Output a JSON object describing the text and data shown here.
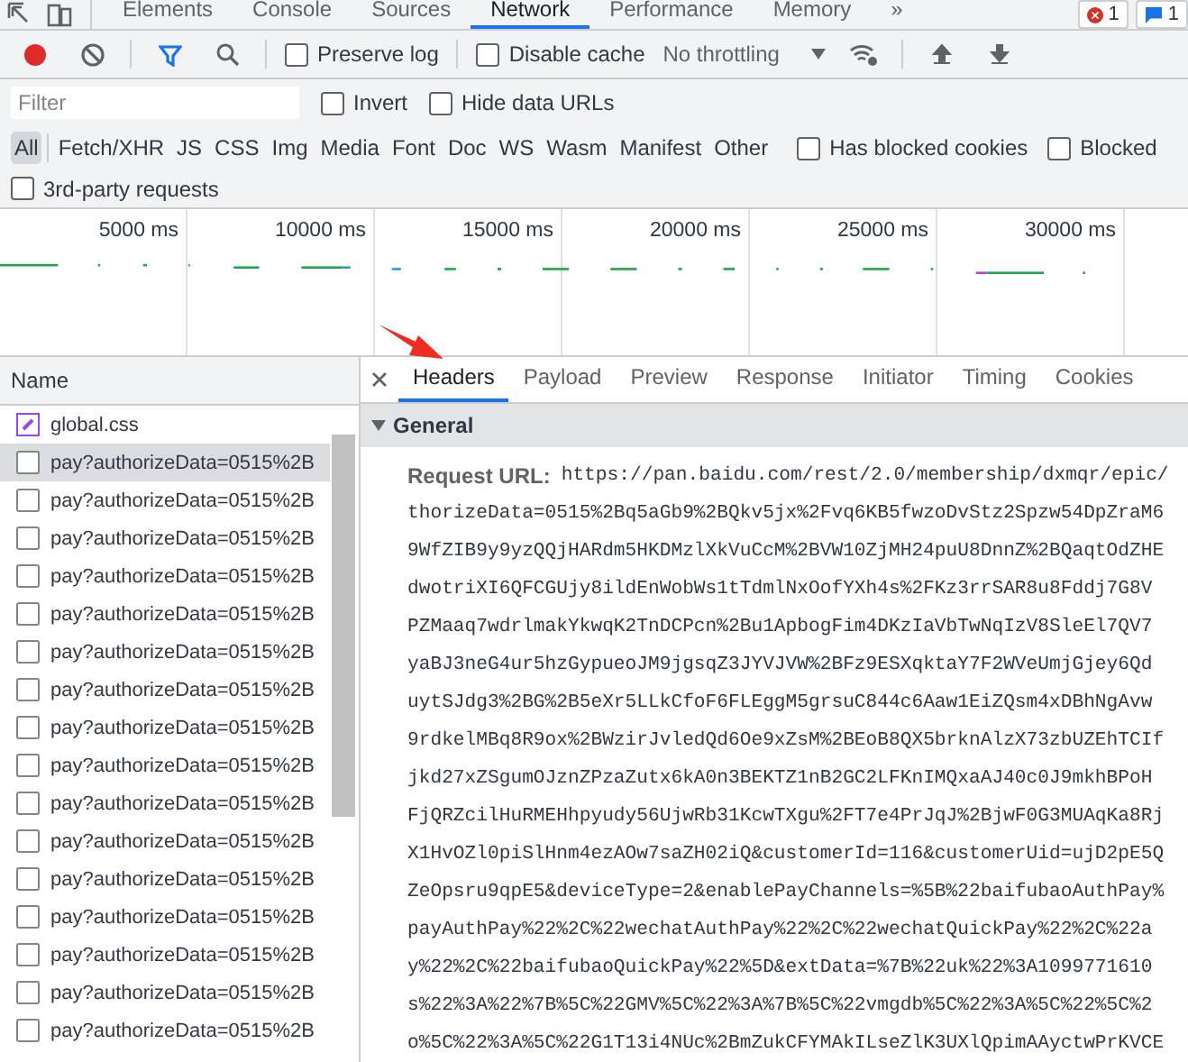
{
  "panel_tabs": [
    {
      "label": "Elements",
      "selected": false
    },
    {
      "label": "Console",
      "selected": false
    },
    {
      "label": "Sources",
      "selected": false
    },
    {
      "label": "Network",
      "selected": true
    },
    {
      "label": "Performance",
      "selected": false
    },
    {
      "label": "Memory",
      "selected": false
    }
  ],
  "more_tabs": "»",
  "counters": [
    {
      "kind": "error",
      "count": "1"
    },
    {
      "kind": "message",
      "count": "1"
    }
  ],
  "toolbar": {
    "recording": true,
    "preserve_log": {
      "label": "Preserve log",
      "checked": false
    },
    "disable_cache": {
      "label": "Disable cache",
      "checked": false
    },
    "throttling": "No throttling"
  },
  "filter": {
    "placeholder": "Filter",
    "options": [
      {
        "label": "Invert",
        "checked": false
      },
      {
        "label": "Hide data URLs",
        "checked": false
      }
    ]
  },
  "type_filters": [
    {
      "label": "All",
      "selected": true
    },
    {
      "label": "Fetch/XHR",
      "selected": false
    },
    {
      "label": "JS",
      "selected": false
    },
    {
      "label": "CSS",
      "selected": false
    },
    {
      "label": "Img",
      "selected": false
    },
    {
      "label": "Media",
      "selected": false
    },
    {
      "label": "Font",
      "selected": false
    },
    {
      "label": "Doc",
      "selected": false
    },
    {
      "label": "WS",
      "selected": false
    },
    {
      "label": "Wasm",
      "selected": false
    },
    {
      "label": "Manifest",
      "selected": false
    },
    {
      "label": "Other",
      "selected": false
    }
  ],
  "type_options": [
    {
      "label": "Has blocked cookies",
      "checked": false
    },
    {
      "label": "Blocked",
      "checked": false
    }
  ],
  "third_party": {
    "label": "3rd-party requests",
    "checked": false
  },
  "timeline": {
    "ticks": [
      "5000 ms",
      "10000 ms",
      "15000 ms",
      "20000 ms",
      "25000 ms",
      "30000 ms"
    ]
  },
  "requests": {
    "column": "Name",
    "rows": [
      {
        "kind": "stylesheet",
        "name": "global.css",
        "selected": false
      },
      {
        "kind": "document",
        "name": "pay?authorizeData=0515%2B",
        "selected": true
      },
      {
        "kind": "document",
        "name": "pay?authorizeData=0515%2B",
        "selected": false
      },
      {
        "kind": "document",
        "name": "pay?authorizeData=0515%2B",
        "selected": false
      },
      {
        "kind": "document",
        "name": "pay?authorizeData=0515%2B",
        "selected": false
      },
      {
        "kind": "document",
        "name": "pay?authorizeData=0515%2B",
        "selected": false
      },
      {
        "kind": "document",
        "name": "pay?authorizeData=0515%2B",
        "selected": false
      },
      {
        "kind": "document",
        "name": "pay?authorizeData=0515%2B",
        "selected": false
      },
      {
        "kind": "document",
        "name": "pay?authorizeData=0515%2B",
        "selected": false
      },
      {
        "kind": "document",
        "name": "pay?authorizeData=0515%2B",
        "selected": false
      },
      {
        "kind": "document",
        "name": "pay?authorizeData=0515%2B",
        "selected": false
      },
      {
        "kind": "document",
        "name": "pay?authorizeData=0515%2B",
        "selected": false
      },
      {
        "kind": "document",
        "name": "pay?authorizeData=0515%2B",
        "selected": false
      },
      {
        "kind": "document",
        "name": "pay?authorizeData=0515%2B",
        "selected": false
      },
      {
        "kind": "document",
        "name": "pay?authorizeData=0515%2B",
        "selected": false
      },
      {
        "kind": "document",
        "name": "pay?authorizeData=0515%2B",
        "selected": false
      },
      {
        "kind": "document",
        "name": "pay?authorizeData=0515%2B",
        "selected": false
      }
    ]
  },
  "detail_tabs": [
    {
      "label": "Headers",
      "selected": true
    },
    {
      "label": "Payload",
      "selected": false
    },
    {
      "label": "Preview",
      "selected": false
    },
    {
      "label": "Response",
      "selected": false
    },
    {
      "label": "Initiator",
      "selected": false
    },
    {
      "label": "Timing",
      "selected": false
    },
    {
      "label": "Cookies",
      "selected": false
    }
  ],
  "general": {
    "title": "General",
    "expanded": true,
    "label": "Request URL:",
    "url_lines": [
      "https://pan.baidu.com/rest/2.0/membership/dxmqr/epic/",
      "thorizeData=0515%2Bq5aGb9%2BQkv5jx%2Fvq6KB5fwzoDvStz2Spzw54DpZraM6",
      "9WfZIB9y9yzQQjHARdm5HKDMzlXkVuCcM%2BVW10ZjMH24puU8DnnZ%2BQaqtOdZHE",
      "dwotriXI6QFCGUjy8ildEnWobWs1tTdmlNxOofYXh4s%2FKz3rrSAR8u8Fddj7G8V",
      "PZMaaq7wdrlmakYkwqK2TnDCPcn%2Bu1ApbogFim4DKzIaVbTwNqIzV8SleEl7QV7",
      "yaBJ3neG4ur5hzGypueoJM9jgsqZ3JYVJVW%2BFz9ESXqktaY7F2WVeUmjGjey6Qd",
      "uytSJdg3%2BG%2B5eXr5LLkCfoF6FLEggM5grsuC844c6Aaw1EiZQsm4xDBhNgAvw",
      "9rdkelMBq8R9ox%2BWzirJvledQd6Oe9xZsM%2BEoB8QX5brknAlzX73zbUZEhTCIf",
      "jkd27xZSgumOJznZPzaZutx6kA0n3BEKTZ1nB2GC2LFKnIMQxaAJ40c0J9mkhBPoH",
      "FjQRZcilHuRMEHhpyudy56UjwRb31KcwTXgu%2FT7e4PrJqJ%2BjwF0G3MUAqKa8Rj",
      "X1HvOZl0piSlHnm4ezAOw7saZH02iQ&customerId=116&customerUid=ujD2pE5Q",
      "ZeOpsru9qpE5&deviceType=2&enablePayChannels=%5B%22baifubaoAuthPay%",
      "payAuthPay%22%2C%22wechatAuthPay%22%2C%22wechatQuickPay%22%2C%22a",
      "y%22%2C%22baifubaoQuickPay%22%5D&extData=%7B%22uk%22%3A1099771610",
      "s%22%3A%22%7B%5C%22GMV%5C%22%3A%7B%5C%22vmgdb%5C%22%3A%5C%22%5C%2",
      "o%5C%22%3A%5C%22G1T13i4NUc%2BmZukCFYMAkILseZlK3UXlQpimAAyctwPrKVCE"
    ]
  }
}
